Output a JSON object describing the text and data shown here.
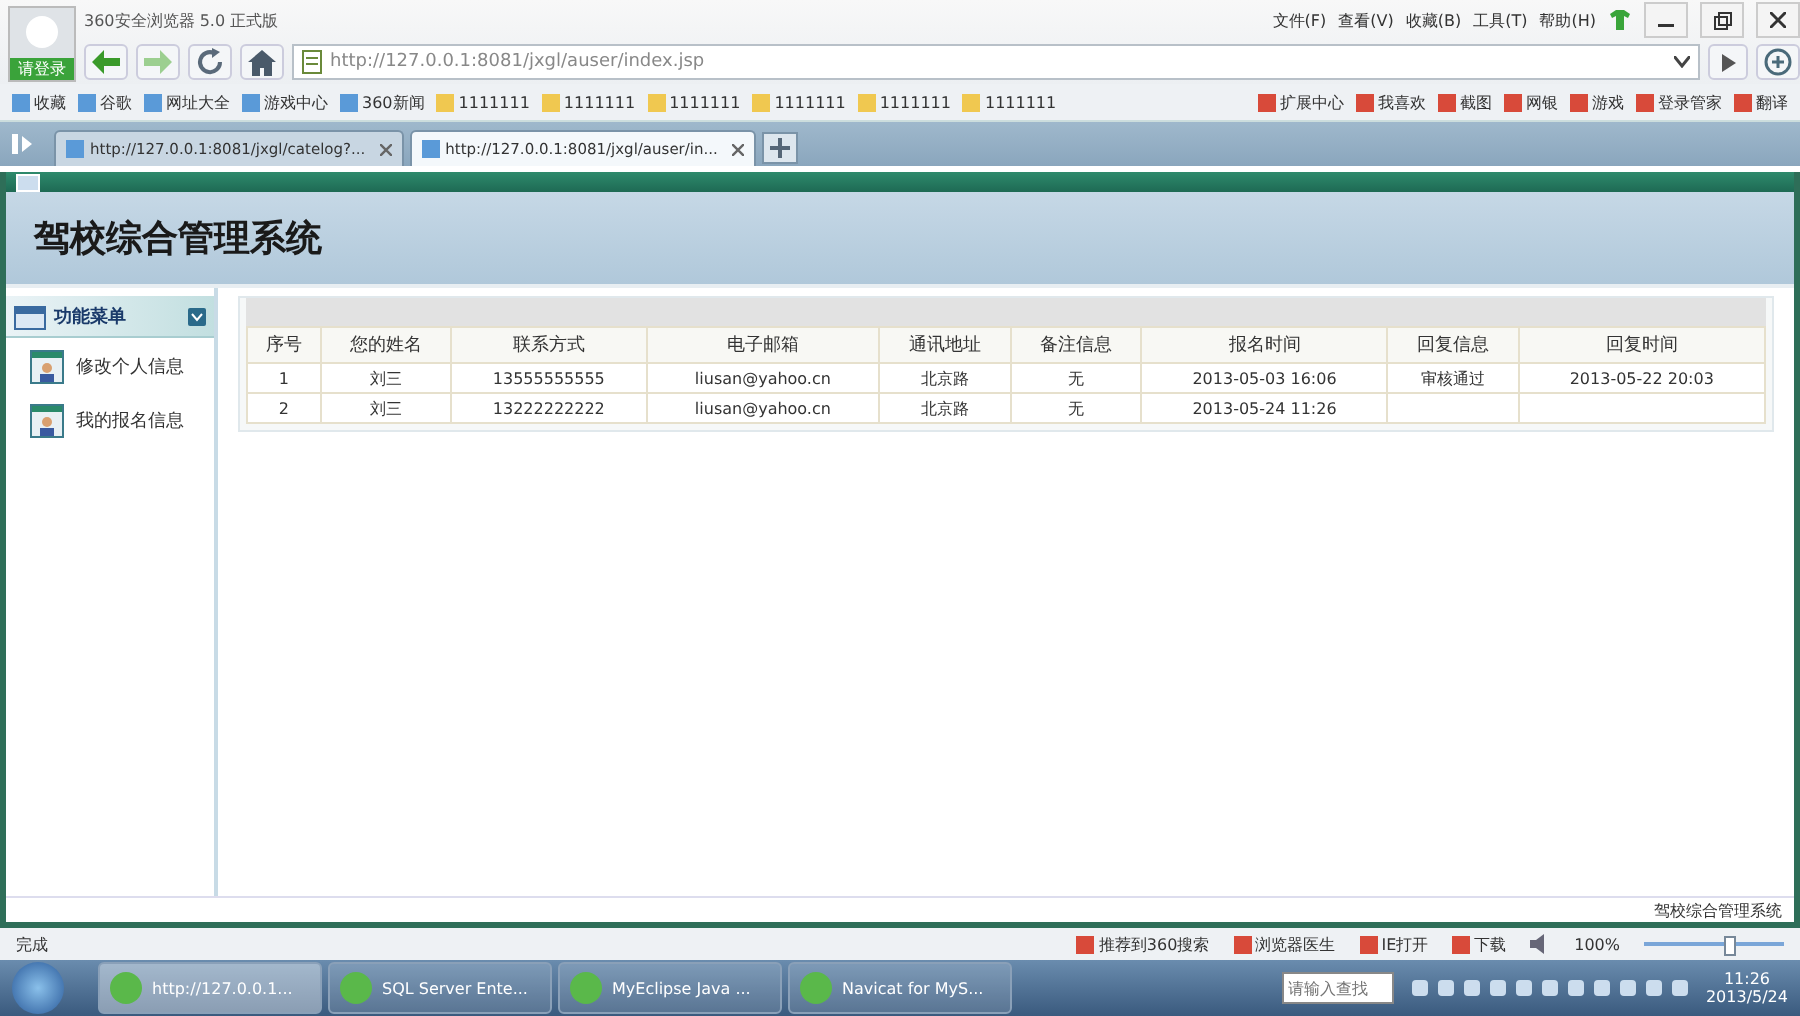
{
  "browser": {
    "title": "360安全浏览器 5.0 正式版",
    "login_label": "请登录",
    "menu": [
      "文件(F)",
      "查看(V)",
      "收藏(B)",
      "工具(T)",
      "帮助(H)"
    ],
    "address": "http://127.0.0.1:8081/jxgl/auser/index.jsp",
    "bookmarks": [
      "收藏",
      "谷歌",
      "网址大全",
      "游戏中心",
      "360新闻",
      "1111111",
      "1111111",
      "1111111",
      "1111111",
      "1111111",
      "1111111"
    ],
    "extensions": [
      "扩展中心",
      "我喜欢",
      "截图",
      "网银",
      "游戏",
      "登录管家",
      "翻译"
    ],
    "tabs": [
      {
        "label": "http://127.0.0.1:8081/jxgl/catelog?...",
        "selected": false
      },
      {
        "label": "http://127.0.0.1:8081/jxgl/auser/in...",
        "selected": true
      }
    ],
    "status": "完成",
    "status_items": [
      "推荐到360搜索",
      "浏览器医生",
      "IE打开",
      "下载"
    ],
    "zoom": "100%",
    "zoom_slider": {
      "level": 0.6
    }
  },
  "app": {
    "title": "驾校综合管理系统",
    "sidebar": {
      "heading": "功能菜单",
      "items": [
        "修改个人信息",
        "我的报名信息"
      ]
    },
    "table": {
      "columns": [
        "序号",
        "您的姓名",
        "联系方式",
        "电子邮箱",
        "通讯地址",
        "备注信息",
        "报名时间",
        "回复信息",
        "回复时间"
      ],
      "rows": [
        [
          "1",
          "刘三",
          "13555555555",
          "liusan@yahoo.cn",
          "北京路",
          "无",
          "2013-05-03 16:06",
          "审核通过",
          "2013-05-22 20:03"
        ],
        [
          "2",
          "刘三",
          "13222222222",
          "liusan@yahoo.cn",
          "北京路",
          "无",
          "2013-05-24 11:26",
          "",
          ""
        ]
      ]
    },
    "footer": "驾校综合管理系统"
  },
  "taskbar": {
    "items": [
      {
        "label": "http://127.0.0.1...",
        "selected": true
      },
      {
        "label": "SQL Server Ente...",
        "selected": false
      },
      {
        "label": "MyEclipse Java ...",
        "selected": false
      },
      {
        "label": "Navicat for MyS...",
        "selected": false
      }
    ],
    "search_placeholder": "请输入查找",
    "time": "11:26",
    "date": "2013/5/24"
  }
}
